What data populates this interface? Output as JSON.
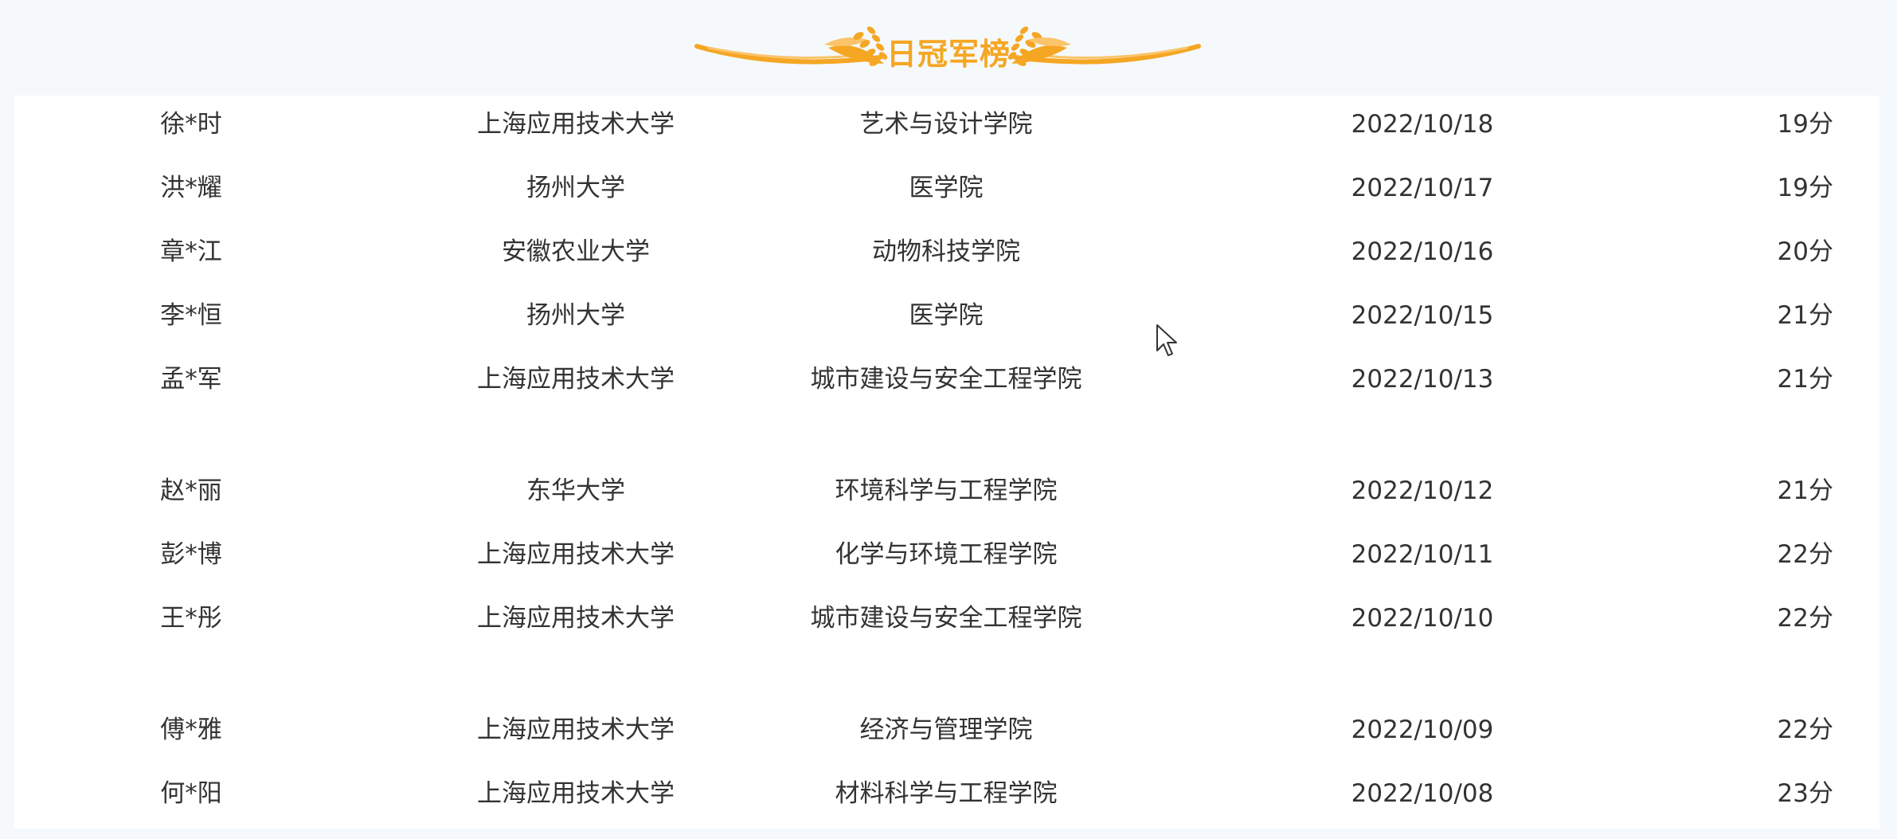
{
  "header": {
    "title": "日冠军榜",
    "accent_color": "#f5a623"
  },
  "rows": [
    {
      "name": "徐*时",
      "school": "上海应用技术大学",
      "college": "艺术与设计学院",
      "date": "2022/10/18",
      "score": "19分"
    },
    {
      "name": "洪*耀",
      "school": "扬州大学",
      "college": "医学院",
      "date": "2022/10/17",
      "score": "19分"
    },
    {
      "name": "章*江",
      "school": "安徽农业大学",
      "college": "动物科技学院",
      "date": "2022/10/16",
      "score": "20分"
    },
    {
      "name": "李*恒",
      "school": "扬州大学",
      "college": "医学院",
      "date": "2022/10/15",
      "score": "21分"
    },
    {
      "name": "孟*军",
      "school": "上海应用技术大学",
      "college": "城市建设与安全工程学院",
      "date": "2022/10/13",
      "score": "21分"
    },
    {
      "name": "赵*丽",
      "school": "东华大学",
      "college": "环境科学与工程学院",
      "date": "2022/10/12",
      "score": "21分"
    },
    {
      "name": "彭*博",
      "school": "上海应用技术大学",
      "college": "化学与环境工程学院",
      "date": "2022/10/11",
      "score": "22分"
    },
    {
      "name": "王*彤",
      "school": "上海应用技术大学",
      "college": "城市建设与安全工程学院",
      "date": "2022/10/10",
      "score": "22分"
    },
    {
      "name": "傅*雅",
      "school": "上海应用技术大学",
      "college": "经济与管理学院",
      "date": "2022/10/09",
      "score": "22分"
    },
    {
      "name": "何*阳",
      "school": "上海应用技术大学",
      "college": "材料科学与工程学院",
      "date": "2022/10/08",
      "score": "23分"
    }
  ]
}
